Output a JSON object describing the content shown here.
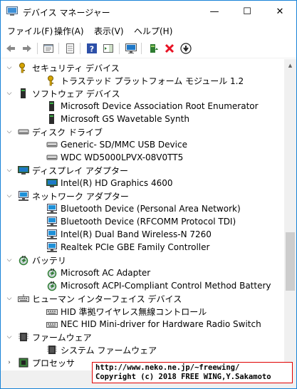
{
  "window": {
    "title": "デバイス マネージャー"
  },
  "titlebar_buttons": {
    "minimize": "—",
    "maximize": "☐",
    "close": "✕"
  },
  "menu": [
    "ファイル(F)",
    "操作(A)",
    "表示(V)",
    "ヘルプ(H)"
  ],
  "toolbar": [
    "back-icon",
    "forward-icon",
    "properties-pane-icon",
    "device-props-icon",
    "help-icon",
    "action-pane-icon",
    "monitor-icon",
    "update-driver-icon",
    "uninstall-icon",
    "download-icon"
  ],
  "tree": {
    "categories": [
      {
        "label": "セキュリティ デバイス",
        "icon": "key-icon",
        "children": [
          {
            "label": "トラステッド プラットフォーム モジュール 1.2",
            "icon": "key-icon"
          }
        ]
      },
      {
        "label": "ソフトウェア デバイス",
        "icon": "device-icon",
        "children": [
          {
            "label": "Microsoft Device Association Root Enumerator",
            "icon": "device-icon"
          },
          {
            "label": "Microsoft GS Wavetable Synth",
            "icon": "device-icon"
          }
        ]
      },
      {
        "label": "ディスク ドライブ",
        "icon": "disk-icon",
        "children": [
          {
            "label": "Generic- SD/MMC USB Device",
            "icon": "disk-icon"
          },
          {
            "label": "WDC WD5000LPVX-08V0TT5",
            "icon": "disk-icon"
          }
        ]
      },
      {
        "label": "ディスプレイ アダプター",
        "icon": "display-icon",
        "children": [
          {
            "label": "Intel(R) HD Graphics 4600",
            "icon": "display-icon"
          }
        ]
      },
      {
        "label": "ネットワーク アダプター",
        "icon": "network-icon",
        "children": [
          {
            "label": "Bluetooth Device (Personal Area Network)",
            "icon": "network-icon"
          },
          {
            "label": "Bluetooth Device (RFCOMM Protocol TDI)",
            "icon": "network-icon"
          },
          {
            "label": "Intel(R) Dual Band Wireless-N 7260",
            "icon": "network-icon"
          },
          {
            "label": "Realtek PCIe GBE Family Controller",
            "icon": "network-icon"
          }
        ]
      },
      {
        "label": "バッテリ",
        "icon": "battery-icon",
        "children": [
          {
            "label": "Microsoft AC Adapter",
            "icon": "battery-icon"
          },
          {
            "label": "Microsoft ACPI-Compliant Control Method Battery",
            "icon": "battery-icon"
          }
        ]
      },
      {
        "label": "ヒューマン インターフェイス デバイス",
        "icon": "hid-icon",
        "children": [
          {
            "label": "HID 準拠ワイヤレス無線コントロール",
            "icon": "hid-icon"
          },
          {
            "label": "NEC HID Mini-driver for Hardware Radio Switch",
            "icon": "hid-icon"
          }
        ]
      },
      {
        "label": "ファームウェア",
        "icon": "firmware-icon",
        "children": [
          {
            "label": "システム ファームウェア",
            "icon": "firmware-icon"
          }
        ]
      },
      {
        "label": "プロセッサ",
        "icon": "processor-icon",
        "children": []
      }
    ]
  },
  "copyright": {
    "line1": "http://www.neko.ne.jp/~freewing/",
    "line2": "Copyright (c) 2018 FREE WING,Y.Sakamoto"
  },
  "colors": {
    "accent": "#1883d7",
    "close_red": "#e81123",
    "monitor_blue": "#1e78c8",
    "device_green": "#2e7d32"
  }
}
